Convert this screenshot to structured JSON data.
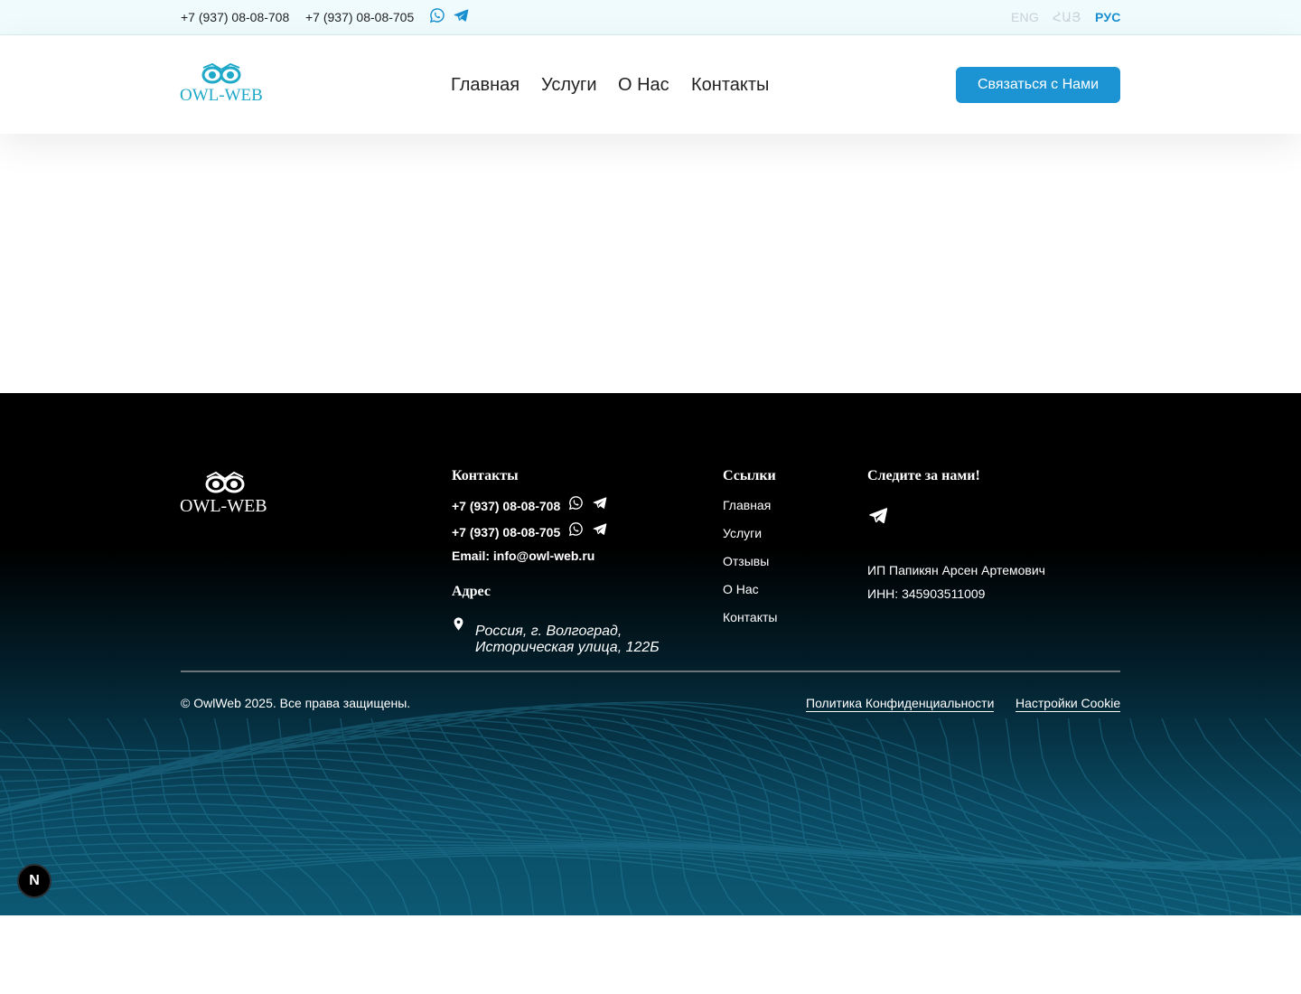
{
  "topbar": {
    "phone1": "+7 (937) 08-08-708",
    "phone2": "+7 (937) 08-08-705",
    "icons": [
      "whatsapp-icon",
      "telegram-icon"
    ],
    "languages": [
      {
        "label": "ENG",
        "active": false
      },
      {
        "label": "ՀԱՅ",
        "active": false
      },
      {
        "label": "РУС",
        "active": true
      }
    ]
  },
  "header": {
    "logo_text": "OWL-WEB",
    "nav": [
      "Главная",
      "Услуги",
      "О Нас",
      "Контакты"
    ],
    "cta_label": "Связаться с Нами"
  },
  "footer": {
    "logo_text": "OWL-WEB",
    "contacts": {
      "title": "Контакты",
      "phone1": "+7 (937) 08-08-708",
      "phone2": "+7 (937) 08-08-705",
      "email": "Email: info@owl-web.ru"
    },
    "address": {
      "title": "Адрес",
      "line1": "Россия, г. Волгоград,",
      "line2": "Историческая улица, 122Б"
    },
    "links": {
      "title": "Ссылки",
      "items": [
        "Главная",
        "Услуги",
        "Отзывы",
        "О Нас",
        "Контакты"
      ]
    },
    "follow": {
      "title": "Следите за нами!",
      "owner": "ИП Папикян Арсен Артемович",
      "inn": "ИНН: 345903511009"
    },
    "copyright": "© OwlWeb 2025. Все права защищены.",
    "privacy": "Политика Конфиденциальности",
    "cookies": "Настройки Cookie",
    "badge": "N"
  },
  "colors": {
    "accent": "#1c93d2",
    "topbar_bg": "#effbfd",
    "logo_teal": "#1fa9c9",
    "footer_dark": "#000000",
    "footer_teal": "#0c5873"
  }
}
